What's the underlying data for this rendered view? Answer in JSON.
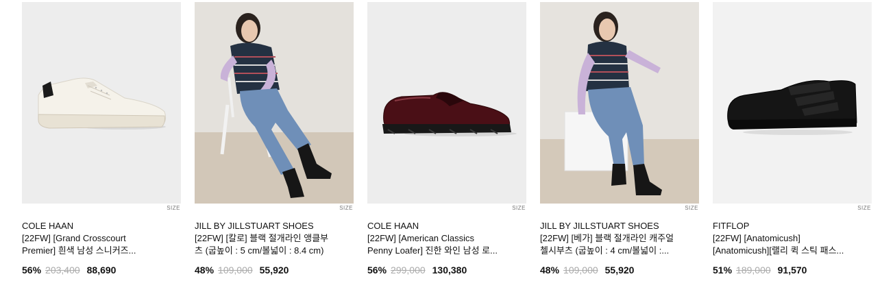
{
  "products": [
    {
      "brand": "COLE HAAN",
      "name_line1": "[22FW] [Grand Crosscourt",
      "name_line2": "Premier] 흰색 남성 스니커즈...",
      "discount": "56%",
      "original_price": "203,400",
      "sale_price": "88,690",
      "size_label": "SIZE",
      "image": "white-sneaker"
    },
    {
      "brand": "JILL BY JILLSTUART SHOES",
      "name_line1": "[22FW] [칼로] 블랙 절개라인 앵클부",
      "name_line2": "츠 (굽높이 : 5 cm/볼넓이 : 8.4 cm)",
      "discount": "48%",
      "original_price": "109,000",
      "sale_price": "55,920",
      "size_label": "SIZE",
      "image": "model-ankle-boots"
    },
    {
      "brand": "COLE HAAN",
      "name_line1": "[22FW] [American Classics",
      "name_line2": "Penny Loafer] 진한 와인 남성 로...",
      "discount": "56%",
      "original_price": "299,000",
      "sale_price": "130,380",
      "size_label": "SIZE",
      "image": "burgundy-loafer"
    },
    {
      "brand": "JILL BY JILLSTUART SHOES",
      "name_line1": "[22FW] [베가] 블랙 절개라인 캐주얼",
      "name_line2": "첼시부츠 (굽높이 : 4 cm/볼넓이 :...",
      "discount": "48%",
      "original_price": "109,000",
      "sale_price": "55,920",
      "size_label": "SIZE",
      "image": "model-chelsea-boots"
    },
    {
      "brand": "FITFLOP",
      "name_line1": "[22FW] [Anatomicush]",
      "name_line2": "[Anatomicush][랠리 퀵 스틱 패스...",
      "discount": "51%",
      "original_price": "189,000",
      "sale_price": "91,570",
      "size_label": "SIZE",
      "image": "black-velcro-sneaker"
    }
  ]
}
